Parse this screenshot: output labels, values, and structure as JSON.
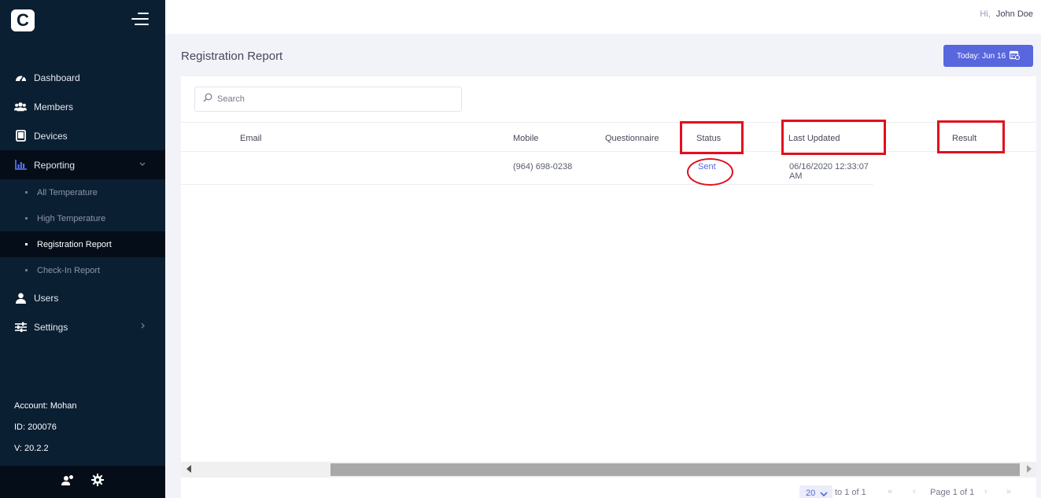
{
  "app": {
    "logo_letter": "C"
  },
  "header": {
    "greeting": "Hi,",
    "user_name": "John Doe"
  },
  "sidebar": {
    "items": [
      {
        "label": "Dashboard",
        "icon": "dashboard-icon"
      },
      {
        "label": "Members",
        "icon": "members-icon"
      },
      {
        "label": "Devices",
        "icon": "devices-icon"
      },
      {
        "label": "Reporting",
        "icon": "reporting-icon",
        "expanded": true,
        "children": [
          {
            "label": "All Temperature"
          },
          {
            "label": "High Temperature"
          },
          {
            "label": "Registration Report",
            "active": true
          },
          {
            "label": "Check-In Report"
          }
        ]
      },
      {
        "label": "Users",
        "icon": "user-icon"
      },
      {
        "label": "Settings",
        "icon": "settings-sliders-icon"
      }
    ],
    "account": {
      "account": "Account: Mohan",
      "id": "ID: 200076",
      "version": "V: 20.2.2"
    }
  },
  "page": {
    "title": "Registration Report",
    "date_button": "Today: Jun 16"
  },
  "search": {
    "placeholder": "Search"
  },
  "table": {
    "columns": [
      "Email",
      "Mobile",
      "Questionnaire",
      "Status",
      "Last Updated",
      "Result"
    ],
    "rows": [
      {
        "email": "",
        "mobile": "(964) 698-0238",
        "questionnaire": "",
        "status": "Sent",
        "last_updated": "06/16/2020 12:33:07 AM",
        "result": ""
      }
    ]
  },
  "pagination": {
    "page_size": "20",
    "range_text": "to 1 of 1",
    "page_text": "Page 1 of 1",
    "first": "«",
    "prev": "‹",
    "next": "›",
    "last": "»"
  },
  "colors": {
    "sidebar": "#0b1f33",
    "accent": "#5867dd",
    "annotation": "#e0101e"
  }
}
